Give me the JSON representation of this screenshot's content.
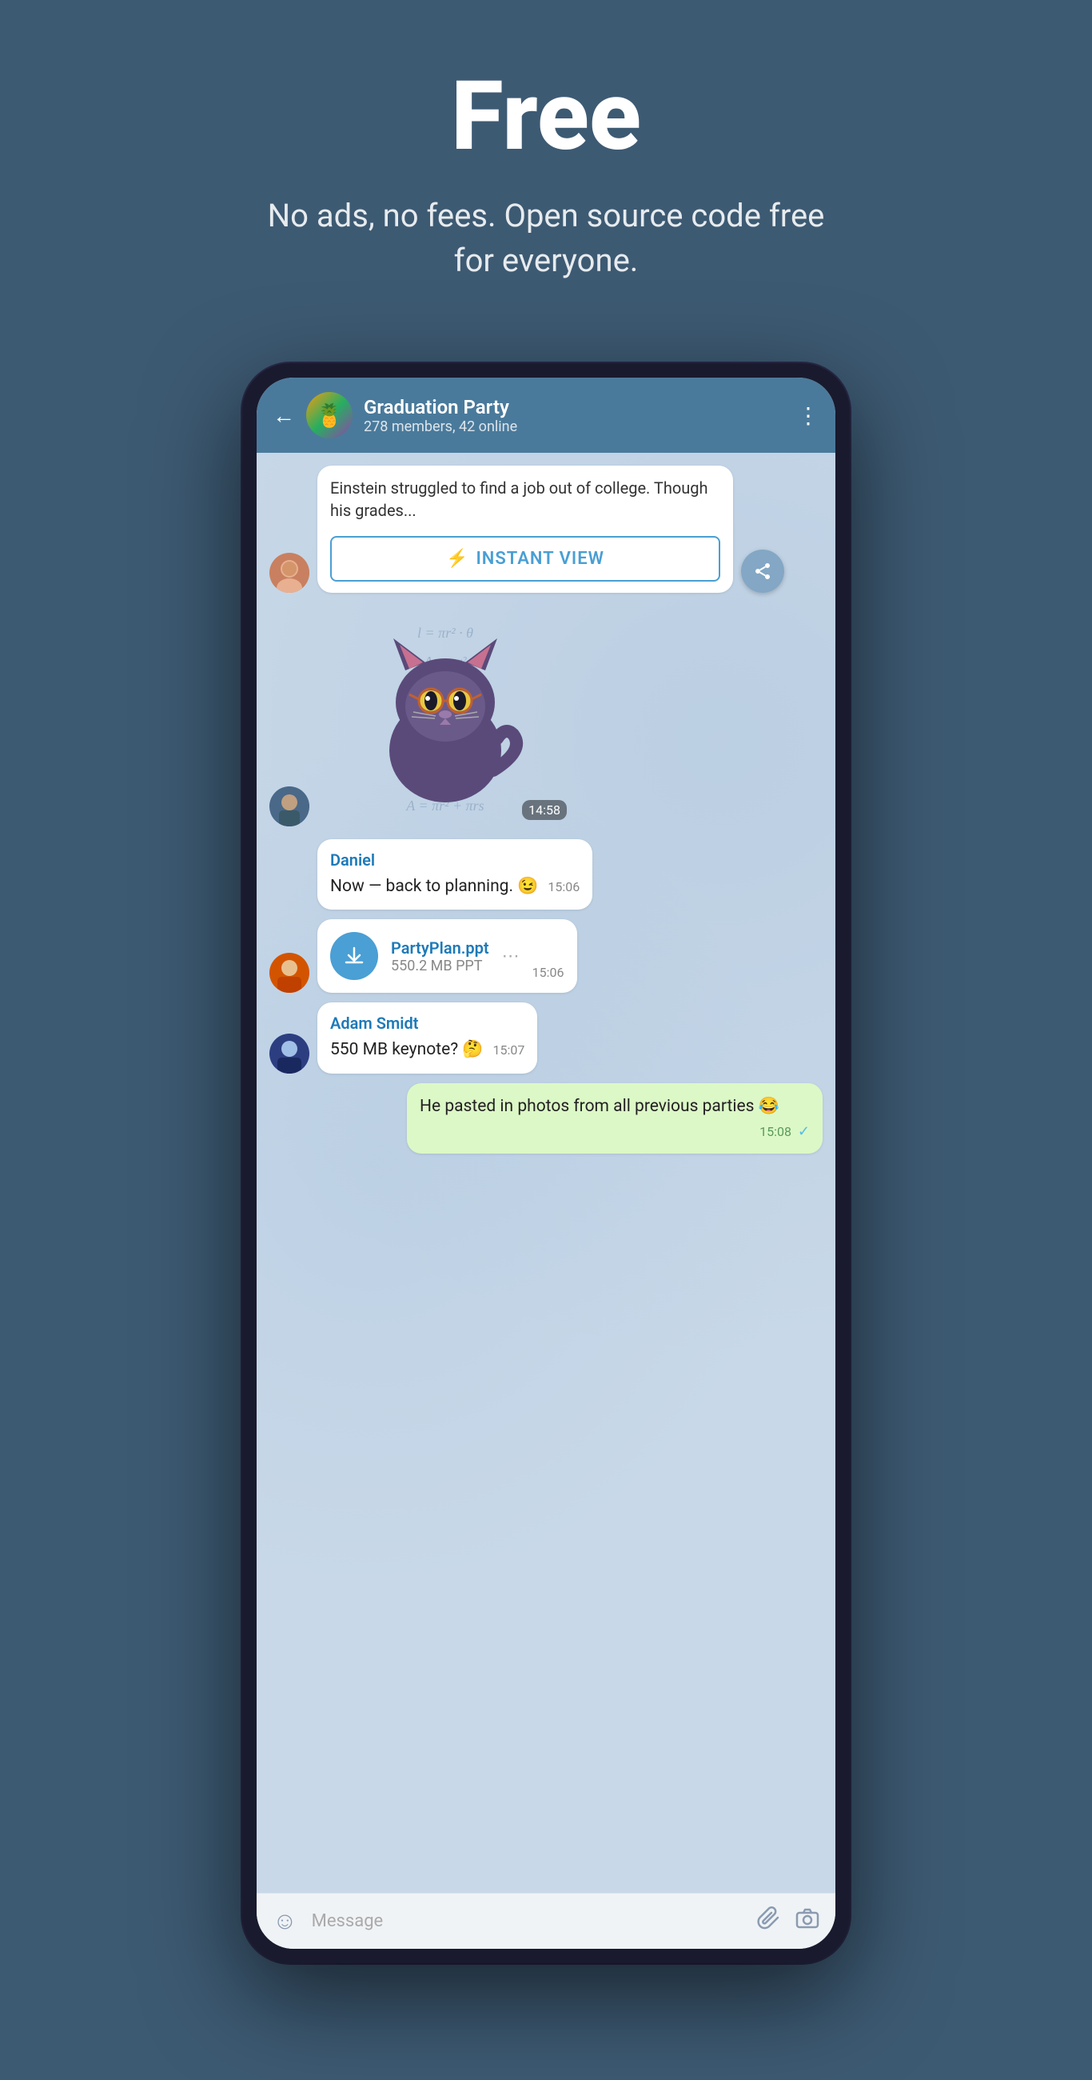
{
  "hero": {
    "title": "Free",
    "subtitle": "No ads, no fees. Open source code free for everyone."
  },
  "chat": {
    "back_label": "←",
    "group_name": "Graduation Party",
    "group_meta": "278 members, 42 online",
    "more_icon": "⋮",
    "article": {
      "text": "Einstein struggled to find a job out of college. Though his grades...",
      "instant_view_label": "INSTANT VIEW",
      "iv_icon": "⚡"
    },
    "sticker_time": "14:58",
    "messages": [
      {
        "sender": "Daniel",
        "text": "Now — back to planning. 😉",
        "time": "15:06",
        "type": "text"
      },
      {
        "sender": null,
        "file_name": "PartyPlan.ppt",
        "file_size": "550.2 MB PPT",
        "time": "15:06",
        "type": "file"
      },
      {
        "sender": "Adam Smidt",
        "text": "550 MB keynote? 🤔",
        "time": "15:07",
        "type": "text"
      },
      {
        "sender": null,
        "text": "He pasted in photos from all previous parties 😂",
        "time": "15:08",
        "type": "own",
        "check": "✓"
      }
    ],
    "input_placeholder": "Message",
    "share_icon": "↪",
    "download_icon": "↓"
  },
  "colors": {
    "background": "#3d5a73",
    "header_bg": "#4a7a9b",
    "chat_bg": "#c8d8e8",
    "bubble_white": "#ffffff",
    "bubble_green": "#dcf8c6",
    "accent_blue": "#4a9fd4",
    "sender_blue": "#1d7ab8"
  }
}
